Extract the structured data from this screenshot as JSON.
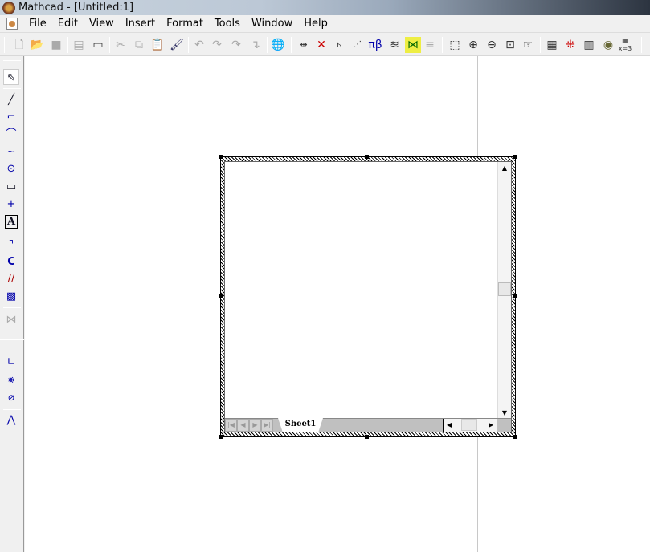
{
  "window": {
    "title": "Mathcad - [Untitled:1]"
  },
  "menu": [
    "File",
    "Edit",
    "View",
    "Insert",
    "Format",
    "Tools",
    "Window",
    "Help"
  ],
  "toolbar": {
    "icons": [
      "new",
      "open",
      "save",
      "print-preview",
      "insert-region",
      "cut",
      "copy",
      "paste",
      "format-painter",
      "undo",
      "undo-list",
      "redo",
      "redo-list",
      "resources",
      "insert-matrix-operator",
      "delete-operator",
      "units",
      "xy-plot",
      "pi-beta",
      "layers",
      "component",
      "properties",
      "zoom-region",
      "zoom-in",
      "zoom-out",
      "fit-to-window",
      "hand",
      "insert-rows",
      "delete-cells",
      "insert-cols",
      "chart",
      "table"
    ],
    "table_icon_label": "x=3"
  },
  "left_toolbar": {
    "icons": [
      "select-arrow",
      "line",
      "polyline",
      "arc",
      "curve",
      "circle",
      "rectangle",
      "point",
      "text",
      "arc-tool",
      "spline-tool",
      "hatching",
      "fill-pattern",
      "disabled-component",
      "dimension",
      "intersect",
      "ellipse-intersect",
      "angle"
    ],
    "text_icon_label": "A"
  },
  "sheet": {
    "tab": "Sheet1"
  }
}
